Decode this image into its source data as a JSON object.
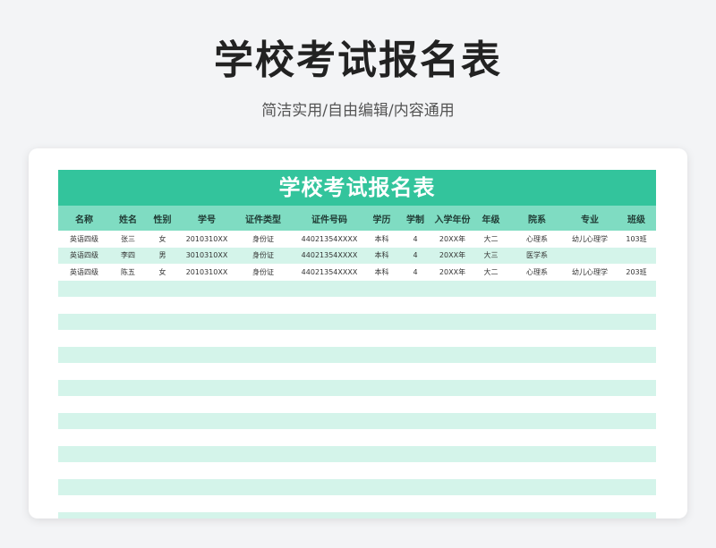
{
  "page": {
    "title": "学校考试报名表",
    "subtitle": "简洁实用/自由编辑/内容通用"
  },
  "sheet": {
    "title": "学校考试报名表",
    "headers": [
      "名称",
      "姓名",
      "性别",
      "学号",
      "证件类型",
      "证件号码",
      "学历",
      "学制",
      "入学年份",
      "年级",
      "院系",
      "专业",
      "班级"
    ],
    "rows": [
      [
        "英语四级",
        "张三",
        "女",
        "2010310XX",
        "身份证",
        "44021354XXXX",
        "本科",
        "4",
        "20XX年",
        "大二",
        "心理系",
        "幼儿心理学",
        "103班"
      ],
      [
        "英语四级",
        "李四",
        "男",
        "3010310XX",
        "身份证",
        "44021354XXXX",
        "本科",
        "4",
        "20XX年",
        "大三",
        "医学系",
        "",
        ""
      ],
      [
        "英语四级",
        "陈五",
        "女",
        "2010310XX",
        "身份证",
        "44021354XXXX",
        "本科",
        "4",
        "20XX年",
        "大二",
        "心理系",
        "幼儿心理学",
        "203班"
      ]
    ],
    "blank_rows": 15
  },
  "colors": {
    "title_bar": "#33c49c",
    "header_row": "#7fdcc2",
    "stripe": "#d4f4ea"
  }
}
